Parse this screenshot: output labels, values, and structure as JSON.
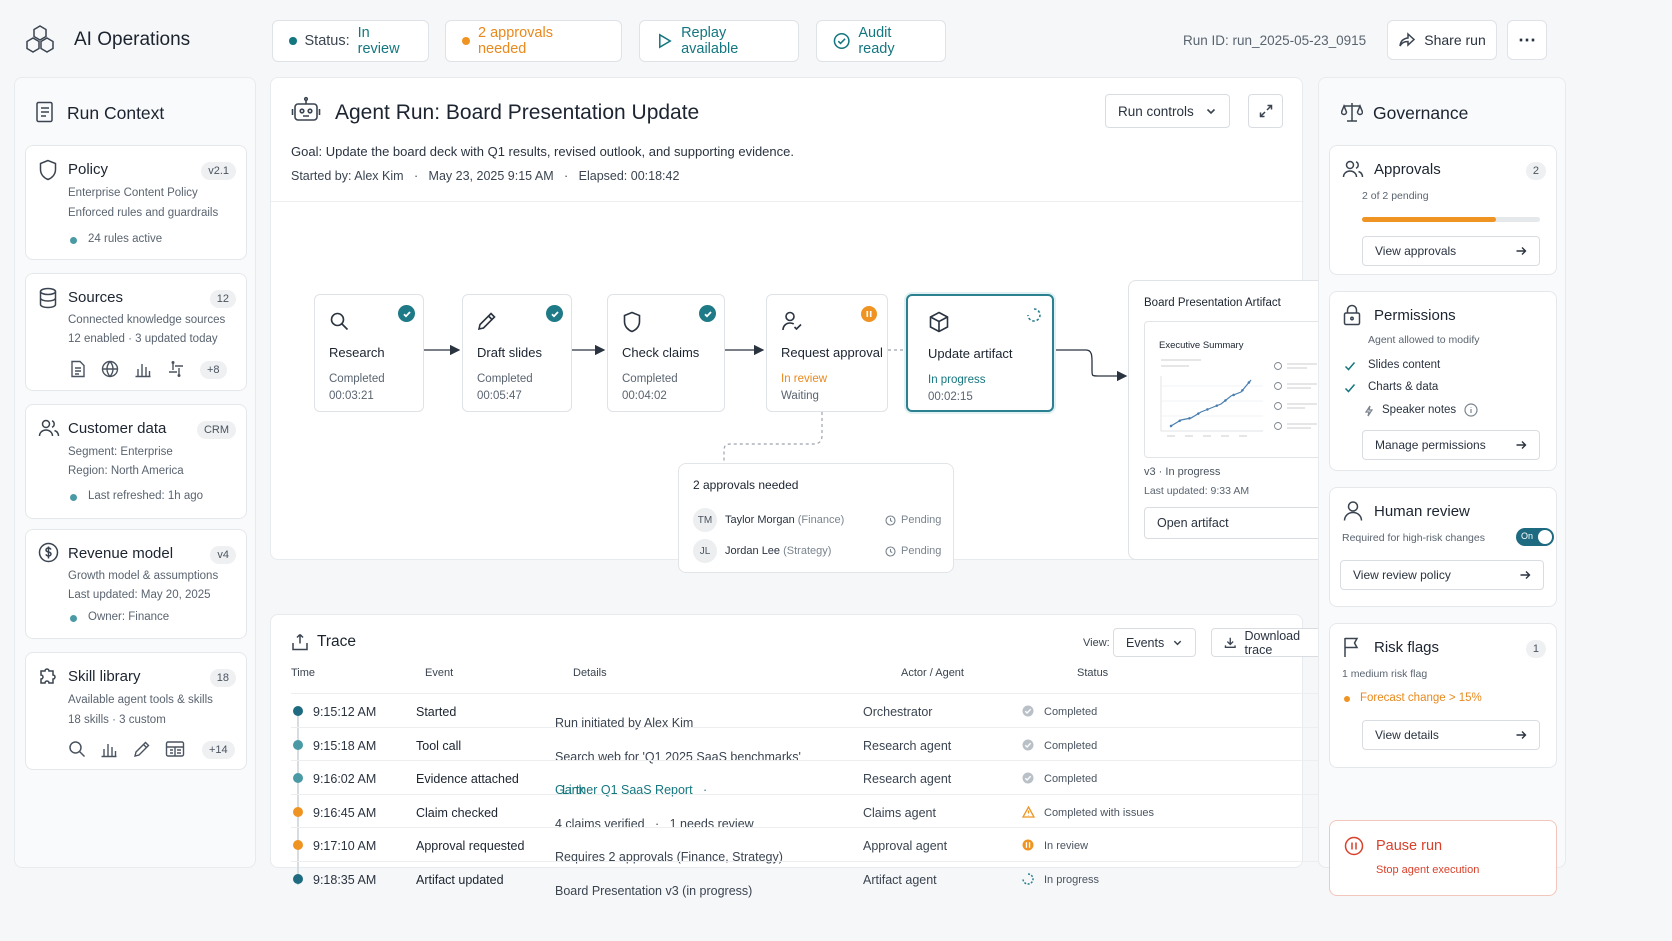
{
  "app": {
    "title": "AI Operations"
  },
  "header": {
    "status_label": "Status:",
    "status_value": "In review",
    "approvals": "2 approvals needed",
    "replay": "Replay available",
    "audit": "Audit ready",
    "runid_label": "Run ID:",
    "runid_value": "run_2025-05-23_0915",
    "share": "Share run",
    "more": "⋯"
  },
  "context": {
    "title": "Run Context",
    "policy": {
      "title": "Policy",
      "badge": "v2.1",
      "l1": "Enterprise Content Policy",
      "l2": "Enforced rules and guardrails",
      "l3": "24 rules active"
    },
    "sources": {
      "title": "Sources",
      "badge": "12",
      "l1": "Connected knowledge sources",
      "l2": "12 enabled  ·  3 updated today",
      "more": "+8"
    },
    "customer": {
      "title": "Customer data",
      "badge": "CRM",
      "l1": "Segment: Enterprise",
      "l2": "Region: North America",
      "l3": "Last refreshed:  1h ago"
    },
    "revenue": {
      "title": "Revenue model",
      "badge": "v4",
      "l1": "Growth model & assumptions",
      "l2": "Last updated:  May 20, 2025",
      "l3": "Owner: Finance"
    },
    "skills": {
      "title": "Skill library",
      "badge": "18",
      "l1": "Available agent tools & skills",
      "l2": "18 skills  ·  3 custom",
      "more": "+14"
    }
  },
  "run": {
    "title": "Agent Run: Board Presentation Update",
    "run_controls": "Run controls",
    "goal_label": "Goal:",
    "goal": "Update the board deck with Q1 results, revised outlook, and supporting evidence.",
    "started": "Started by: Alex Kim   ·   May 23, 2025 9:15 AM   ·   Elapsed: 00:18:42",
    "steps": [
      {
        "title": "Research",
        "s1": "Completed",
        "s2": "00:03:21"
      },
      {
        "title": "Draft slides",
        "s1": "Completed",
        "s2": "00:05:47"
      },
      {
        "title": "Check claims",
        "s1": "Completed",
        "s2": "00:04:02"
      },
      {
        "title": "Request approval",
        "s1": "In review",
        "s2": "Waiting"
      },
      {
        "title": "Update artifact",
        "s1": "In progress",
        "s2": "00:02:15"
      }
    ],
    "approvals_box": {
      "title": "2 approvals needed",
      "a1_initials": "TM",
      "a1_name": "Taylor Morgan",
      "a1_role": "(Finance)",
      "a1_status": "Pending",
      "a2_initials": "JL",
      "a2_name": "Jordan Lee",
      "a2_role": "(Strategy)",
      "a2_status": "Pending"
    },
    "artifact": {
      "title": "Board Presentation Artifact",
      "thumb_title": "Executive Summary",
      "version": "v3  ·  In progress",
      "updated": "Last updated: 9:33 AM",
      "open": "Open artifact"
    }
  },
  "trace": {
    "title": "Trace",
    "view_label": "View:",
    "view_value": "Events",
    "download": "Download trace",
    "columns": [
      "Time",
      "Event",
      "Details",
      "Actor / Agent",
      "Status"
    ],
    "rows": [
      {
        "time": "9:15:12 AM",
        "event": "Started",
        "details": "Run initiated by Alex Kim",
        "link": "",
        "actor": "Orchestrator",
        "status": "Completed",
        "color": "#1e6a80"
      },
      {
        "time": "9:15:18 AM",
        "event": "Tool call",
        "details": "Search web for 'Q1 2025 SaaS benchmarks'",
        "link": "",
        "actor": "Research agent",
        "status": "Completed",
        "color": "#4a9aa6"
      },
      {
        "time": "9:16:02 AM",
        "event": "Evidence attached",
        "details": "Gartner Q1 SaaS Report   ·",
        "link": "Link",
        "actor": "Research agent",
        "status": "Completed",
        "color": "#4a9aa6"
      },
      {
        "time": "9:16:45 AM",
        "event": "Claim checked",
        "details": "4 claims verified   ·   1 needs review",
        "link": "",
        "actor": "Claims agent",
        "status": "Completed with issues",
        "color": "#ef9422"
      },
      {
        "time": "9:17:10 AM",
        "event": "Approval requested",
        "details": "Requires 2 approvals (Finance, Strategy)",
        "link": "",
        "actor": "Approval agent",
        "status": "In review",
        "color": "#ef9422"
      },
      {
        "time": "9:18:35 AM",
        "event": "Artifact updated",
        "details": "Board Presentation v3 (in progress)",
        "link": "",
        "actor": "Artifact agent",
        "status": "In progress",
        "color": "#1e6a80"
      }
    ]
  },
  "gov": {
    "title": "Governance",
    "approvals": {
      "title": "Approvals",
      "badge": "2",
      "sub": "2 of 2 pending",
      "progress": 0.75,
      "btn": "View approvals"
    },
    "permissions": {
      "title": "Permissions",
      "sub": "Agent allowed to modify",
      "p1": "Slides content",
      "p2": "Charts & data",
      "p3": "Speaker notes",
      "btn": "Manage permissions"
    },
    "review": {
      "title": "Human review",
      "sub": "Required for high-risk changes",
      "toggle": "On",
      "btn": "View review policy"
    },
    "risk": {
      "title": "Risk flags",
      "badge": "1",
      "sub": "1 medium risk flag",
      "flag": "Forecast change > 15%",
      "btn": "View details"
    },
    "pause": {
      "title": "Pause run",
      "sub": "Stop agent execution"
    }
  },
  "colors": {
    "teal": "#14767f",
    "orange": "#e8891c",
    "red": "#d9412b"
  }
}
